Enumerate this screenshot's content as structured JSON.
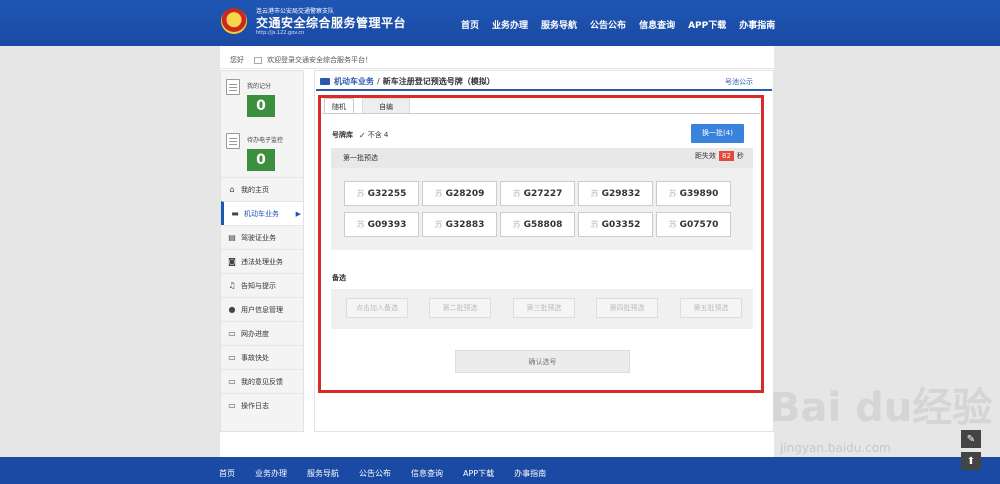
{
  "header": {
    "brand_sub": "连云港市公安局交通警察支队",
    "brand_title": "交通安全综合服务管理平台",
    "brand_url": "http://js.122.gov.cn",
    "nav": [
      "首页",
      "业务办理",
      "服务导航",
      "公告公布",
      "信息查询",
      "APP下载",
      "办事指南"
    ]
  },
  "welcome": {
    "greeting": "您好",
    "message": "欢迎登录交通安全综合服务平台！"
  },
  "sidebar": {
    "score_label": "我的记分",
    "score_value": "0",
    "monitor_label": "待办电子监控",
    "monitor_value": "0",
    "items": [
      {
        "label": "我的主页",
        "icon": "home-icon",
        "glyph": "⌂"
      },
      {
        "label": "机动车业务",
        "icon": "car-icon",
        "glyph": "▬",
        "active": true
      },
      {
        "label": "驾驶证业务",
        "icon": "license-icon",
        "glyph": "▤"
      },
      {
        "label": "违法处理业务",
        "icon": "camera-icon",
        "glyph": "◙"
      },
      {
        "label": "告知与提示",
        "icon": "bell-icon",
        "glyph": "♫"
      },
      {
        "label": "用户信息管理",
        "icon": "user-icon",
        "glyph": "●"
      },
      {
        "label": "网办进度",
        "icon": "progress-icon",
        "glyph": "▭"
      },
      {
        "label": "事故快处",
        "icon": "accident-icon",
        "glyph": "▭"
      },
      {
        "label": "我的意见反馈",
        "icon": "feedback-icon",
        "glyph": "▭"
      },
      {
        "label": "操作日志",
        "icon": "log-icon",
        "glyph": "▭"
      }
    ]
  },
  "breadcrumb": {
    "section": "机动车业务",
    "separator": "/",
    "page": "新车注册登记预选号牌（模拟）"
  },
  "notice_link": "号池公示",
  "tabs": [
    "随机",
    "自编"
  ],
  "pool": {
    "label": "号牌库",
    "check": "✓",
    "value": "不含 4"
  },
  "swap_button": "换一批(4)",
  "batch": {
    "title": "第一批预选",
    "countdown_prefix": "距失效",
    "countdown_value": "82",
    "countdown_unit": "秒",
    "province": "苏",
    "plates": [
      "G32255",
      "G28209",
      "G27227",
      "G29832",
      "G39890",
      "G09393",
      "G32883",
      "G58808",
      "G03352",
      "G07570"
    ]
  },
  "backup": {
    "label": "备选",
    "slots": [
      "点击加入备选",
      "第二批预选",
      "第三批预选",
      "第四批预选",
      "第五批预选"
    ]
  },
  "confirm_button": "确认选号",
  "footer": {
    "nav": [
      "首页",
      "业务办理",
      "服务导航",
      "公告公布",
      "信息查询",
      "APP下载",
      "办事指南"
    ]
  },
  "watermark": {
    "main": "Bai du经验",
    "sub": "jingyan.baidu.com"
  },
  "colors": {
    "primary": "#1f56b4",
    "accent_red": "#d92a2a",
    "score_green": "#3b8f3d",
    "button_blue": "#3a83dc"
  }
}
